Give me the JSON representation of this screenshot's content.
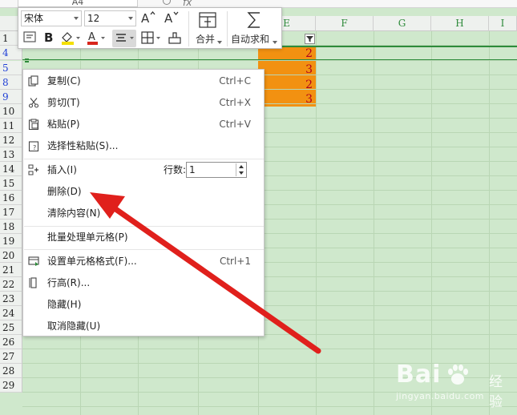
{
  "formula_bar": {
    "name_box": "A4",
    "fx": "fx"
  },
  "columns": [
    {
      "label": "",
      "id": "a"
    },
    {
      "label": "",
      "id": "b"
    },
    {
      "label": "",
      "id": "c"
    },
    {
      "label": "",
      "id": "d"
    },
    {
      "label": "E",
      "id": "e"
    },
    {
      "label": "F",
      "id": "f"
    },
    {
      "label": "G",
      "id": "g"
    },
    {
      "label": "H",
      "id": "h"
    },
    {
      "label": "I",
      "id": "i"
    }
  ],
  "rows": [
    "1",
    "4",
    "5",
    "8",
    "9",
    "10",
    "11",
    "12",
    "13",
    "14",
    "15",
    "16",
    "17",
    "18",
    "19",
    "20",
    "21",
    "22",
    "23",
    "24",
    "25",
    "26",
    "27",
    "28",
    "29"
  ],
  "column_e_values": [
    "2",
    "3",
    "2",
    "3"
  ],
  "mini_toolbar": {
    "font_name": "宋体",
    "font_size": "12",
    "merge_label": "合并",
    "autosum_label": "自动求和"
  },
  "context_menu": {
    "copy": {
      "label": "复制(C)",
      "shortcut": "Ctrl+C"
    },
    "cut": {
      "label": "剪切(T)",
      "shortcut": "Ctrl+X"
    },
    "paste": {
      "label": "粘贴(P)",
      "shortcut": "Ctrl+V"
    },
    "paste_special": {
      "label": "选择性粘贴(S)..."
    },
    "insert": {
      "label": "插入(I)",
      "rows_label": "行数:",
      "rows_value": "1"
    },
    "delete": {
      "label": "删除(D)"
    },
    "clear": {
      "label": "清除内容(N)"
    },
    "batch": {
      "label": "批量处理单元格(P)"
    },
    "format_cells": {
      "label": "设置单元格格式(F)...",
      "shortcut": "Ctrl+1"
    },
    "row_height": {
      "label": "行高(R)..."
    },
    "hide": {
      "label": "隐藏(H)"
    },
    "unhide": {
      "label": "取消隐藏(U)"
    }
  },
  "watermark": {
    "main": "Bai",
    "brand_cn": "经验",
    "url": "jingyan.baidu.com"
  },
  "colors": {
    "grid_bg": "#cfe8cc",
    "highlight": "#f29111",
    "selection": "#2e8b3a",
    "arrow": "#e0201c"
  }
}
